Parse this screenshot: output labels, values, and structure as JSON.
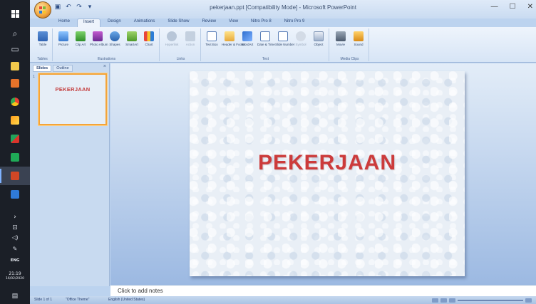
{
  "taskbar": {
    "time": "21:19",
    "date": "16/02/2020",
    "language": "ENG",
    "expand_glyph": "›"
  },
  "window": {
    "title": "pekerjaan.ppt [Compatibility Mode] - Microsoft PowerPoint",
    "controls": [
      "—",
      "☐",
      "✕"
    ]
  },
  "tabs": [
    "Home",
    "Insert",
    "Design",
    "Animations",
    "Slide Show",
    "Review",
    "View",
    "Nitro Pro 8",
    "Nitro Pro 9"
  ],
  "active_tab": "Insert",
  "ribbon": {
    "groups": [
      {
        "label": "Tables",
        "buttons": [
          "Table"
        ]
      },
      {
        "label": "Illustrations",
        "buttons": [
          "Picture",
          "Clip Art",
          "Photo Album",
          "Shapes",
          "SmartArt",
          "Chart"
        ]
      },
      {
        "label": "Links",
        "buttons": [
          "Hyperlink",
          "Action"
        ]
      },
      {
        "label": "Text",
        "buttons": [
          "Text Box",
          "Header & Footer",
          "WordArt",
          "Date & Time",
          "Slide Number",
          "Symbol",
          "Object"
        ]
      },
      {
        "label": "Media Clips",
        "buttons": [
          "Movie",
          "Sound"
        ]
      }
    ]
  },
  "slides_pane": {
    "tabs": [
      "Slides",
      "Outline"
    ],
    "close": "×",
    "thumbnail_number": "1",
    "thumbnail_title": "PEKERJAAN"
  },
  "slide": {
    "title": "PEKERJAAN"
  },
  "notes": {
    "placeholder": "Click to add notes"
  },
  "status": {
    "slide_count": "Slide 1 of 1",
    "theme": "\"Office Theme\"",
    "language": "English (United States)"
  }
}
